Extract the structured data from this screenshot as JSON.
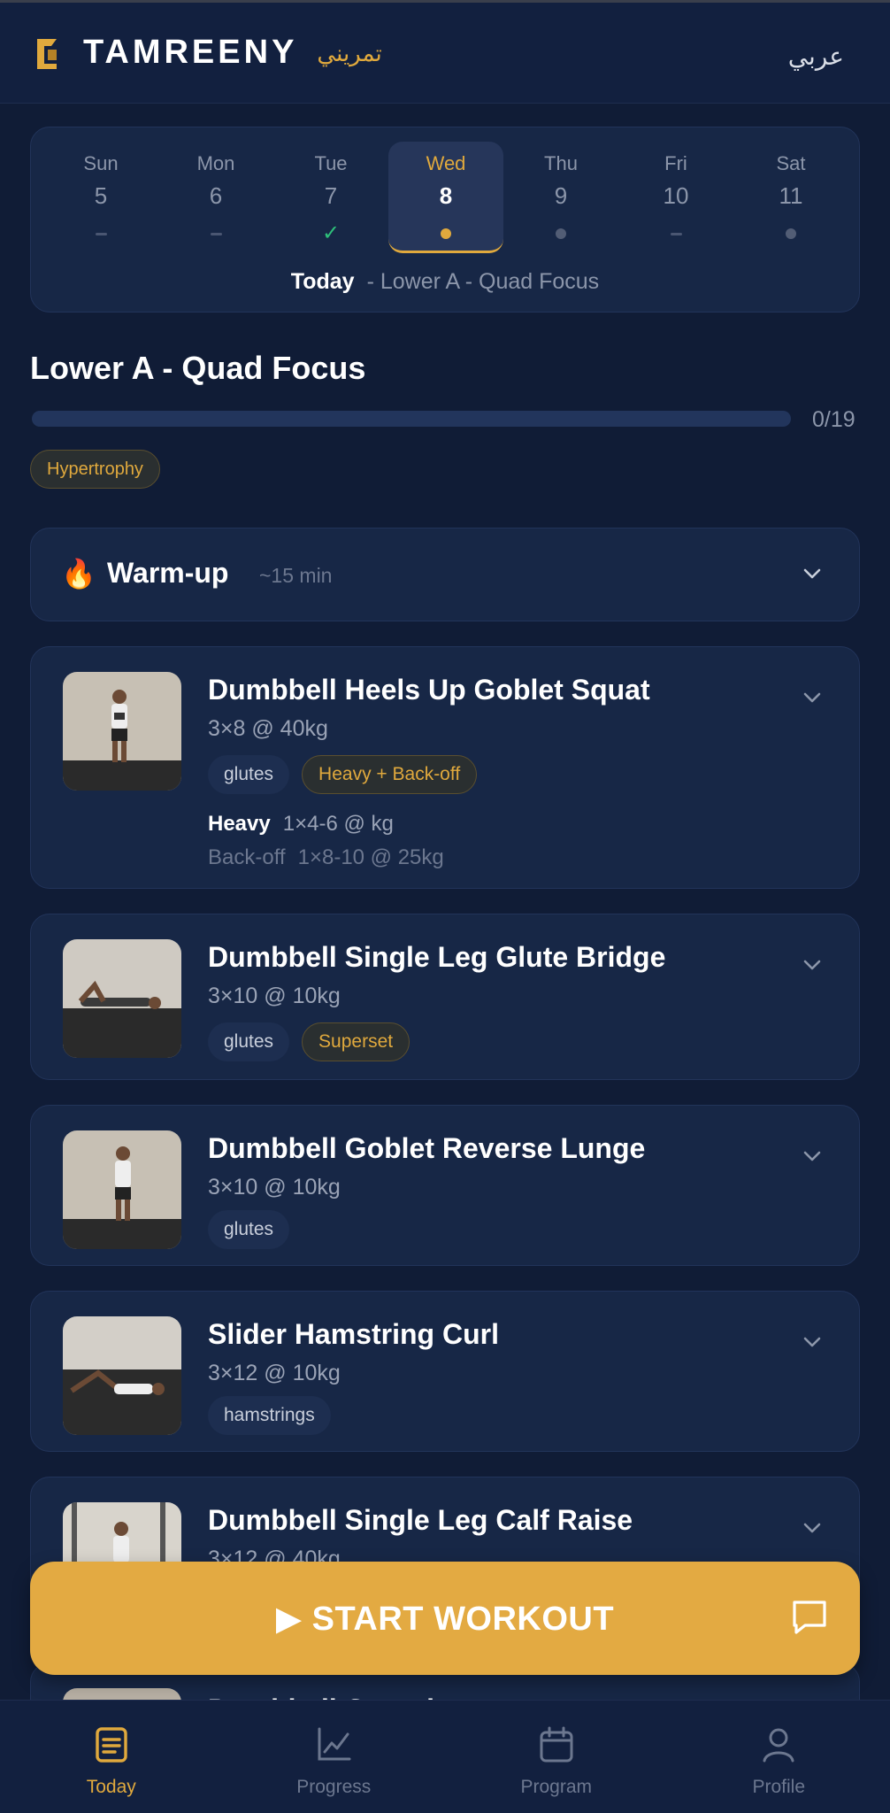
{
  "header": {
    "brand": "TAMREENY",
    "brand_arabic": "تمريني",
    "language_toggle": "عربي",
    "colors": {
      "accent": "#e0a93d",
      "background": "#101c36"
    }
  },
  "calendar": {
    "days": [
      {
        "name": "Sun",
        "date": "5",
        "status": "rest"
      },
      {
        "name": "Mon",
        "date": "6",
        "status": "rest"
      },
      {
        "name": "Tue",
        "date": "7",
        "status": "done",
        "mark": "✓"
      },
      {
        "name": "Wed",
        "date": "8",
        "status": "today"
      },
      {
        "name": "Thu",
        "date": "9",
        "status": "scheduled"
      },
      {
        "name": "Fri",
        "date": "10",
        "status": "rest"
      },
      {
        "name": "Sat",
        "date": "11",
        "status": "scheduled"
      }
    ],
    "today_label": "Today",
    "today_workout": "- Lower A - Quad Focus"
  },
  "workout": {
    "title": "Lower A - Quad Focus",
    "progress_text": "0/19",
    "progress_fraction": 0,
    "goal_tag": "Hypertrophy"
  },
  "warmup": {
    "icon": "flame-icon",
    "emoji": "🔥",
    "label": "Warm-up",
    "duration": "~15 min"
  },
  "exercises": [
    {
      "name": "Dumbbell Heels Up Goblet Squat",
      "scheme": "3×8 @ 40kg",
      "tags": [
        "glutes"
      ],
      "special_tag": "Heavy + Back-off",
      "heavy_label": "Heavy",
      "heavy_value": "1×4-6 @ kg",
      "backoff_label": "Back-off",
      "backoff_value": "1×8-10 @ 25kg"
    },
    {
      "name": "Dumbbell Single Leg Glute Bridge",
      "scheme": "3×10 @ 10kg",
      "tags": [
        "glutes"
      ],
      "special_tag": "Superset"
    },
    {
      "name": "Dumbbell Goblet Reverse Lunge",
      "scheme": "3×10 @ 10kg",
      "tags": [
        "glutes"
      ]
    },
    {
      "name": "Slider Hamstring Curl",
      "scheme": "3×12 @ 10kg",
      "tags": [
        "hamstrings"
      ]
    },
    {
      "name": "Dumbbell Single Leg Calf Raise",
      "scheme": "3×12 @ 40kg"
    },
    {
      "name": "Dumbbell Crunch"
    }
  ],
  "start_button": {
    "label": "▶ START WORKOUT",
    "chat_icon": "chat-icon"
  },
  "bottom_nav": [
    {
      "label": "Today",
      "icon": "today-icon",
      "active": true
    },
    {
      "label": "Progress",
      "icon": "chart-icon",
      "active": false
    },
    {
      "label": "Program",
      "icon": "calendar-icon",
      "active": false
    },
    {
      "label": "Profile",
      "icon": "user-icon",
      "active": false
    }
  ]
}
